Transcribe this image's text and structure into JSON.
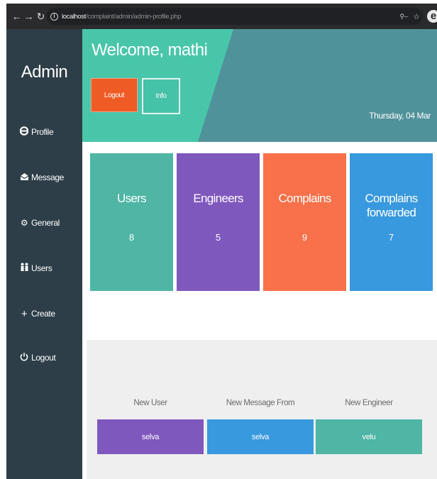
{
  "browser": {
    "url_host": "localhost",
    "url_path": "/complaint/admin/admin-profile.php",
    "profile_initial": "e"
  },
  "sidebar": {
    "brand": "Admin",
    "items": [
      {
        "label": "Profile",
        "icon": "user-icon"
      },
      {
        "label": "Message",
        "icon": "envelope-icon"
      },
      {
        "label": "General",
        "icon": "gear-icon"
      },
      {
        "label": "Users",
        "icon": "users-icon"
      },
      {
        "label": "Create",
        "icon": "plus-icon"
      },
      {
        "label": "Logout",
        "icon": "power-icon"
      }
    ]
  },
  "header": {
    "welcome": "Welcome, mathi",
    "logout_label": "Logout",
    "info_label": "Info",
    "date": "Thursday, 04 Mar"
  },
  "stats": [
    {
      "title": "Users",
      "count": "8",
      "color": "#4fb5a4"
    },
    {
      "title": "Engineers",
      "count": "5",
      "color": "#7f58be"
    },
    {
      "title": "Complains",
      "count": "9",
      "color": "#f9714a"
    },
    {
      "title": "Complains forwarded",
      "count": "7",
      "color": "#3899de"
    }
  ],
  "recent": [
    {
      "label": "New User",
      "value": "selva",
      "color": "#7f58be"
    },
    {
      "label": "New Message From",
      "value": "selva",
      "color": "#3899de"
    },
    {
      "label": "New Engineer",
      "value": "velu",
      "color": "#4fb5a4"
    }
  ],
  "colors": {
    "sidebar": "#2e3e48",
    "header_teal": "#50929a",
    "header_mint": "#49c6a9",
    "logout": "#ef5b24"
  }
}
